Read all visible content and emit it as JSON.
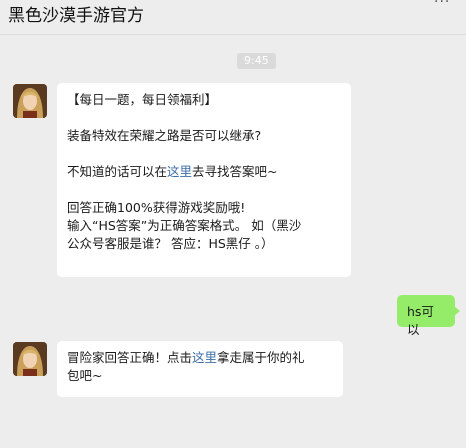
{
  "header": {
    "title": "黑色沙漠手游官方",
    "more_icon": "more-dots-icon"
  },
  "time_label": "9:45",
  "messages": [
    {
      "sender": "official",
      "avatar_icon": "character-avatar",
      "lines": {
        "heading": "【每日一题，每日领福利】",
        "question": "装备特效在荣耀之路是否可以继承?",
        "hint_pre": "不知道的话可以在",
        "hint_link": "这里",
        "hint_post": "去寻找答案吧~",
        "reward": "回答正确100%获得游戏奖励哦!",
        "format1": "输入“HS答案”为正确答案格式。 如（黑沙",
        "format2": "公众号客服是谁？ 答应：HS黑仔 。）"
      }
    },
    {
      "sender": "user",
      "text": "hs可以"
    },
    {
      "sender": "official",
      "avatar_icon": "character-avatar",
      "lines": {
        "pre": "冒险家回答正确！点击",
        "link": "这里",
        "post": "拿走属于你的礼",
        "line2": "包吧~"
      }
    }
  ],
  "colors": {
    "background": "#ededed",
    "user_bubble": "#95ec69",
    "link": "#3b6ea8"
  }
}
